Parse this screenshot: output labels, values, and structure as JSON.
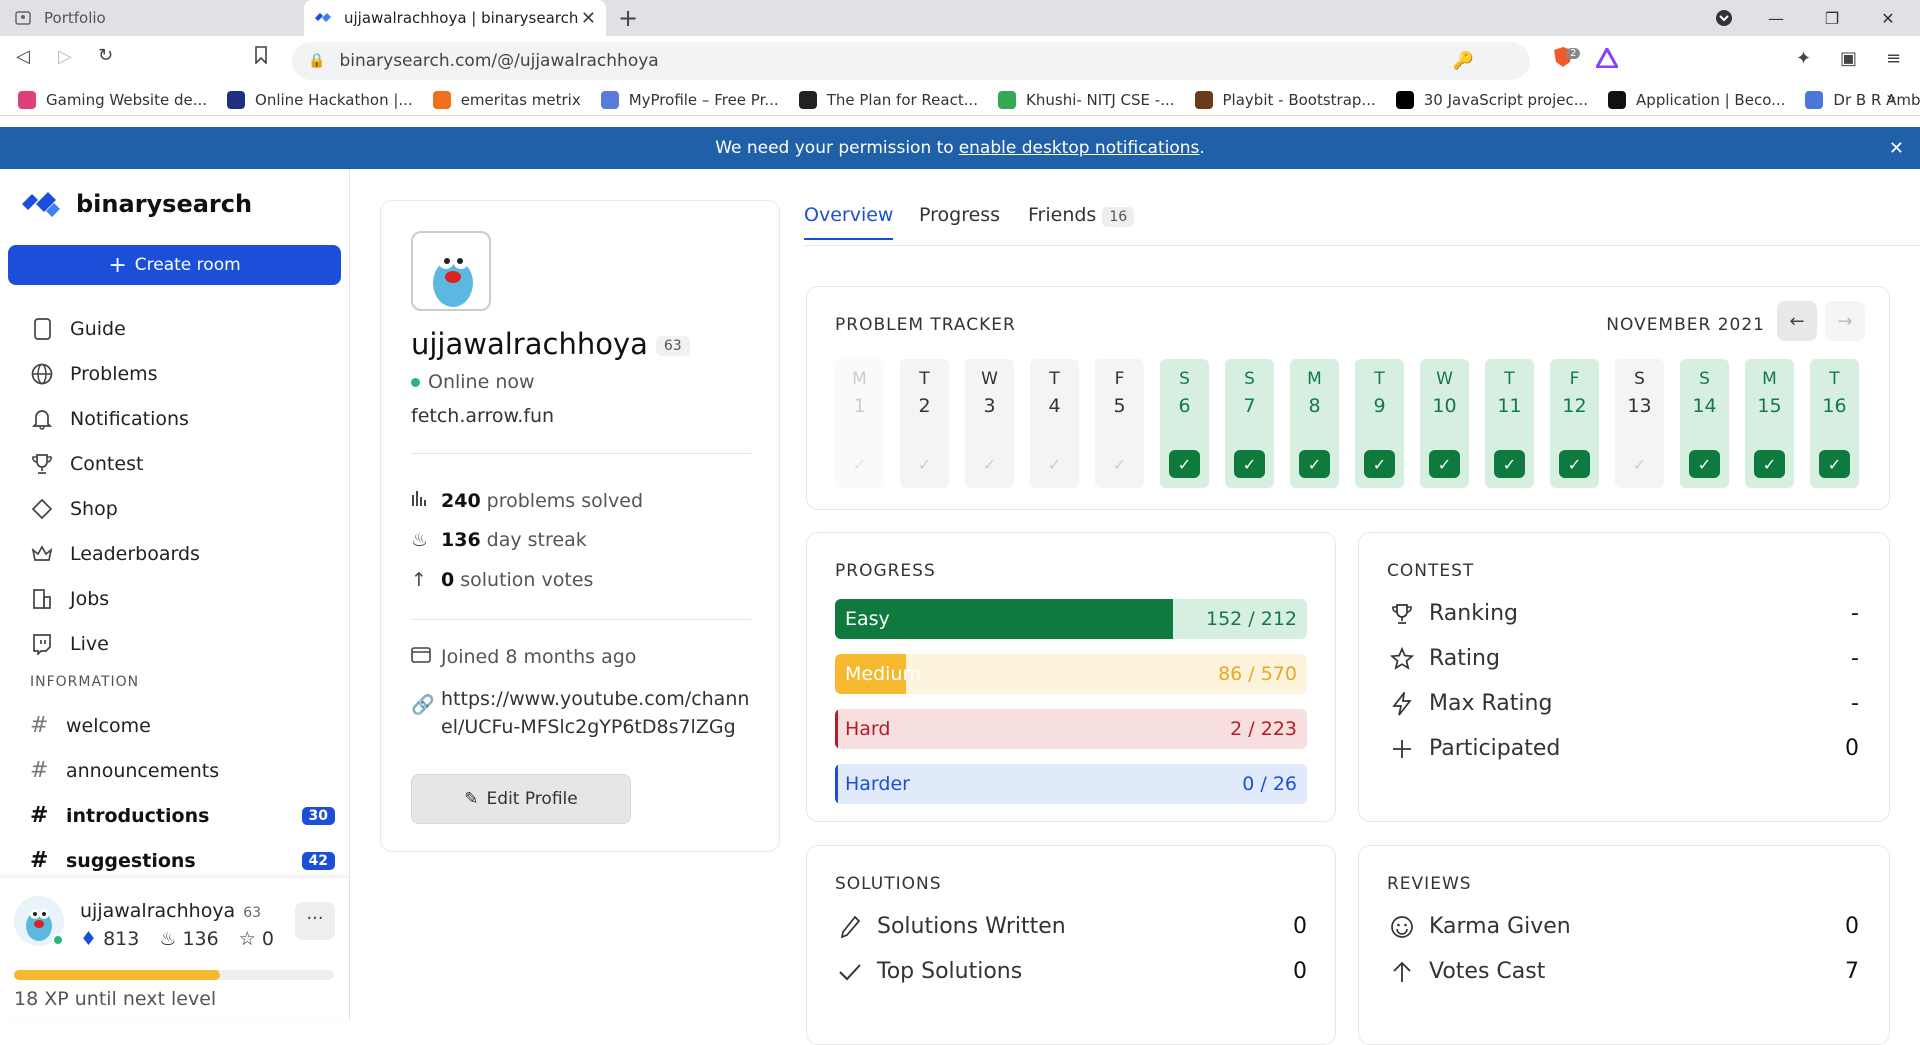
{
  "browser": {
    "tabs": [
      {
        "title": "Portfolio"
      },
      {
        "title": "ujjawalrachhoya | binarysearch"
      }
    ],
    "url": "binarysearch.com/@/ujjawalrachhoya",
    "bookmarks": [
      {
        "label": "Gaming Website de...",
        "color": "#e0407a"
      },
      {
        "label": "Online Hackathon |...",
        "color": "#203080"
      },
      {
        "label": "emeritas metrix",
        "color": "#f07020"
      },
      {
        "label": "MyProfile – Free Pr...",
        "color": "#5a7bd8"
      },
      {
        "label": "The Plan for React...",
        "color": "#222222"
      },
      {
        "label": "Khushi- NITJ CSE -...",
        "color": "#34a853"
      },
      {
        "label": "Playbit - Bootstrap...",
        "color": "#6b3a1a"
      },
      {
        "label": "30 JavaScript projec...",
        "color": "#000000"
      },
      {
        "label": "Application | Beco...",
        "color": "#111111"
      },
      {
        "label": "Dr B R Ambedkar N...",
        "color": "#4a78d8"
      }
    ],
    "bookmark_more": "»",
    "ext_badge": "2"
  },
  "notification": {
    "prefix": "We need your permission to",
    "link": "enable desktop notifications",
    "suffix": "."
  },
  "sidebar": {
    "brand": "binarysearch",
    "create_label": "Create room",
    "nav": [
      {
        "label": "Guide",
        "icon": "book-icon"
      },
      {
        "label": "Problems",
        "icon": "globe-icon"
      },
      {
        "label": "Notifications",
        "icon": "bell-icon"
      },
      {
        "label": "Contest",
        "icon": "trophy-icon"
      },
      {
        "label": "Shop",
        "icon": "tag-icon"
      },
      {
        "label": "Leaderboards",
        "icon": "crown-icon"
      },
      {
        "label": "Jobs",
        "icon": "building-icon"
      },
      {
        "label": "Live",
        "icon": "twitch-icon"
      }
    ],
    "section": "INFORMATION",
    "channels": [
      {
        "name": "welcome",
        "badge": null
      },
      {
        "name": "announcements",
        "badge": null
      },
      {
        "name": "introductions",
        "badge": "30"
      },
      {
        "name": "suggestions",
        "badge": "42"
      }
    ],
    "user": {
      "name": "ujjawalrachhoya",
      "level": "63",
      "gems": "813",
      "streak": "136",
      "stars": "0",
      "xp_fraction": 0.645,
      "xp_text": "18 XP until next level"
    }
  },
  "profile": {
    "name": "ujjawalrachhoya",
    "level": "63",
    "status": "Online now",
    "bio": "fetch.arrow.fun",
    "solved_num": "240",
    "solved_text": "problems solved",
    "streak_num": "136",
    "streak_text": "day streak",
    "votes_num": "0",
    "votes_text": "solution votes",
    "joined": "Joined 8 months ago",
    "link": "https://www.youtube.com/channel/UCFu-MFSlc2gYP6tD8s7lZGg",
    "edit_label": "Edit Profile"
  },
  "tabs": {
    "overview": "Overview",
    "progress": "Progress",
    "friends": "Friends",
    "friends_count": "16"
  },
  "tracker": {
    "title": "PROBLEM TRACKER",
    "month": "NOVEMBER 2021",
    "days": [
      {
        "l": "M",
        "n": "1",
        "s": "faded"
      },
      {
        "l": "T",
        "n": "2",
        "s": "none"
      },
      {
        "l": "W",
        "n": "3",
        "s": "none"
      },
      {
        "l": "T",
        "n": "4",
        "s": "none"
      },
      {
        "l": "F",
        "n": "5",
        "s": "none"
      },
      {
        "l": "S",
        "n": "6",
        "s": "done"
      },
      {
        "l": "S",
        "n": "7",
        "s": "done"
      },
      {
        "l": "M",
        "n": "8",
        "s": "done"
      },
      {
        "l": "T",
        "n": "9",
        "s": "done"
      },
      {
        "l": "W",
        "n": "10",
        "s": "done"
      },
      {
        "l": "T",
        "n": "11",
        "s": "done"
      },
      {
        "l": "F",
        "n": "12",
        "s": "done"
      },
      {
        "l": "S",
        "n": "13",
        "s": "none"
      },
      {
        "l": "S",
        "n": "14",
        "s": "done"
      },
      {
        "l": "M",
        "n": "15",
        "s": "done"
      },
      {
        "l": "T",
        "n": "16",
        "s": "done"
      }
    ]
  },
  "progress": {
    "title": "PROGRESS",
    "bars": [
      {
        "label": "Easy",
        "solved": 152,
        "total": 212,
        "text": "152 / 212",
        "fill": "#0f7a3e",
        "bg": "#d7efe1",
        "label_color": "#ffffff",
        "count_color": "#137a47"
      },
      {
        "label": "Medium",
        "solved": 86,
        "total": 570,
        "text": "86 / 570",
        "fill": "#f5b82e",
        "bg": "#fdf3dc",
        "label_color": "#ffffff",
        "count_color": "#e8a820"
      },
      {
        "label": "Hard",
        "solved": 2,
        "total": 223,
        "text": "2 / 223",
        "fill": "#b31d28",
        "bg": "#f7dfe0",
        "label_color": "#b31d28",
        "count_color": "#b31d28"
      },
      {
        "label": "Harder",
        "solved": 0,
        "total": 26,
        "text": "0 / 26",
        "fill": "#1b4fd9",
        "bg": "#e1eafb",
        "label_color": "#1b4fd9",
        "count_color": "#1b4fd9"
      }
    ]
  },
  "contest": {
    "title": "CONTEST",
    "rows": [
      {
        "label": "Ranking",
        "value": "-",
        "icon": "trophy-icon"
      },
      {
        "label": "Rating",
        "value": "-",
        "icon": "star-icon"
      },
      {
        "label": "Max Rating",
        "value": "-",
        "icon": "bolt-icon"
      },
      {
        "label": "Participated",
        "value": "0",
        "icon": "plus-icon"
      }
    ]
  },
  "solutions": {
    "title": "SOLUTIONS",
    "rows": [
      {
        "label": "Solutions Written",
        "value": "0",
        "icon": "pen-icon"
      },
      {
        "label": "Top Solutions",
        "value": "0",
        "icon": "check-icon"
      }
    ]
  },
  "reviews": {
    "title": "REVIEWS",
    "rows": [
      {
        "label": "Karma Given",
        "value": "0",
        "icon": "smile-icon"
      },
      {
        "label": "Votes Cast",
        "value": "7",
        "icon": "arrow-up-icon"
      }
    ]
  }
}
